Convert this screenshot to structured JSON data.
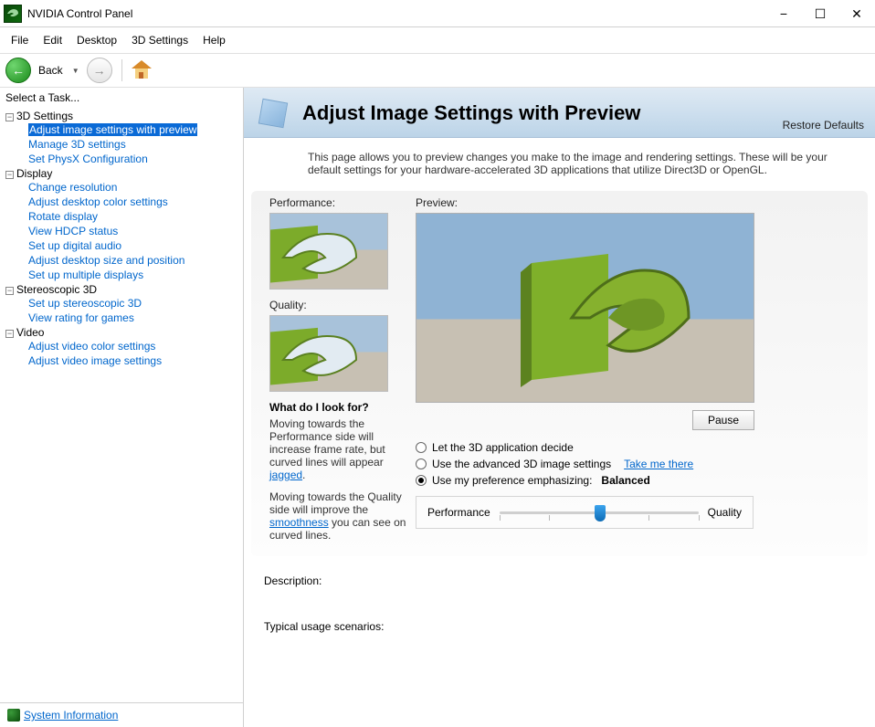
{
  "window": {
    "title": "NVIDIA Control Panel"
  },
  "menu": [
    "File",
    "Edit",
    "Desktop",
    "3D Settings",
    "Help"
  ],
  "nav": {
    "back": "Back"
  },
  "side": {
    "header": "Select a Task...",
    "groups": [
      {
        "name": "3D Settings",
        "items": [
          "Adjust image settings with preview",
          "Manage 3D settings",
          "Set PhysX Configuration"
        ],
        "selected": 0
      },
      {
        "name": "Display",
        "items": [
          "Change resolution",
          "Adjust desktop color settings",
          "Rotate display",
          "View HDCP status",
          "Set up digital audio",
          "Adjust desktop size and position",
          "Set up multiple displays"
        ]
      },
      {
        "name": "Stereoscopic 3D",
        "items": [
          "Set up stereoscopic 3D",
          "View rating for games"
        ]
      },
      {
        "name": "Video",
        "items": [
          "Adjust video color settings",
          "Adjust video image settings"
        ]
      }
    ],
    "sysinfo": "System Information"
  },
  "page": {
    "title": "Adjust Image Settings with Preview",
    "restore": "Restore Defaults",
    "intro": "This page allows you to preview changes you make to the image and rendering settings. These will be your default settings for your hardware-accelerated 3D applications that utilize Direct3D or OpenGL.",
    "perf_label": "Performance:",
    "qual_label": "Quality:",
    "preview_label": "Preview:",
    "pause": "Pause",
    "opts": {
      "a": "Let the 3D application decide",
      "b": "Use the advanced 3D image settings",
      "take": "Take me there",
      "c": "Use my preference emphasizing:",
      "balanced": "Balanced"
    },
    "slider": {
      "left": "Performance",
      "right": "Quality"
    },
    "what_hdr": "What do I look for?",
    "what1a": "Moving towards the Performance side will increase frame rate, but curved lines will appear ",
    "what1b": "jagged",
    "what1c": ".",
    "what2a": "Moving towards the Quality side will improve the ",
    "what2b": "smoothness",
    "what2c": " you can see on curved lines.",
    "desc": "Description:",
    "usage": "Typical usage scenarios:"
  }
}
